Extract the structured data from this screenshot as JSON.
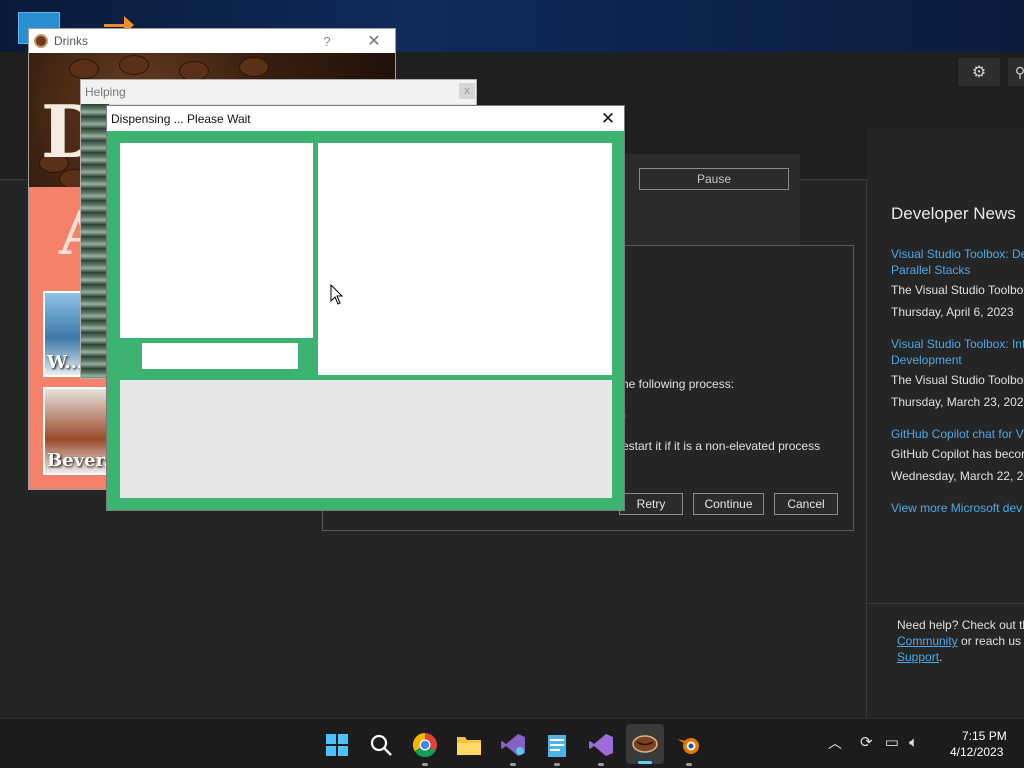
{
  "vs": {
    "pause_label": "Pause",
    "process_dialog": {
      "line1": "he following process:",
      "line2": ")",
      "line3": "estart it if it is a non-elevated process",
      "retry_label": "Retry",
      "continue_label": "Continue",
      "cancel_label": "Cancel"
    },
    "news": {
      "title": "Developer News",
      "items": [
        {
          "link_line1": "Visual Studio Toolbox: De",
          "link_line2": "Parallel Stacks",
          "desc": "The Visual Studio Toolbox",
          "date": "Thursday, April 6, 2023"
        },
        {
          "link_line1": "Visual Studio Toolbox: Int",
          "link_line2": "Development",
          "desc": "The Visual Studio Toolbox",
          "date": "Thursday, March 23, 2023"
        },
        {
          "link_line1": "GitHub Copilot chat for V",
          "link_line2": "",
          "desc": "GitHub Copilot has becor",
          "date": "Wednesday, March 22, 20"
        }
      ],
      "view_more": "View more Microsoft dev"
    },
    "help": {
      "line1": "Need help? Check out th",
      "community": "Community",
      "line2_rest": " or reach us",
      "support": "Support",
      "period": "."
    }
  },
  "drinks": {
    "title": "Drinks",
    "help_glyph": "?",
    "close_glyph": "✕",
    "banner_letter": "D",
    "content_letter": "A",
    "card1_label": "W...",
    "card2_label": "Bever..."
  },
  "helping": {
    "title": "Helping",
    "close_glyph": "x"
  },
  "dispensing": {
    "title": "Dispensing ... Please Wait",
    "close_glyph": "✕"
  },
  "colors": {
    "dialog_green": "#3cb371",
    "accent_blue": "#60cdff",
    "link_blue": "#4fa8e8"
  },
  "taskbar": {
    "time": "7:15 PM",
    "date": "4/12/2023",
    "icons": [
      "windows-start-icon",
      "search-icon",
      "chrome-icon",
      "file-explorer-icon",
      "visual-studio-preview-icon",
      "notepad-icon",
      "visual-studio-icon",
      "coffee-app-icon",
      "blender-icon"
    ]
  }
}
